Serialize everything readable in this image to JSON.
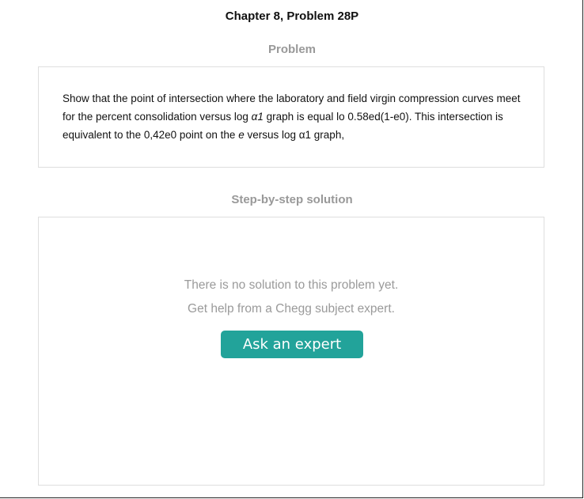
{
  "header": {
    "chapter_title": "Chapter 8, Problem 28P"
  },
  "problem": {
    "heading": "Problem",
    "text_part1": "Show that the point of intersection where the laboratory and field virgin compression curves meet for the percent consolidation versus log ",
    "text_sym1": "α1",
    "text_part2": " graph is equal lo 0.58ed(1-e0). This intersection is equivalent to the 0,42e0 point on the ",
    "text_sym2": "e",
    "text_part3": " versus log α1 graph,"
  },
  "solution": {
    "heading": "Step-by-step solution",
    "no_solution_text": "There is no solution to this problem yet.",
    "help_text": "Get help from a Chegg subject expert.",
    "ask_button_label": "Ask an expert"
  },
  "colors": {
    "accent": "#22a39a",
    "muted_text": "#9a9a9a",
    "border": "#dedede"
  }
}
